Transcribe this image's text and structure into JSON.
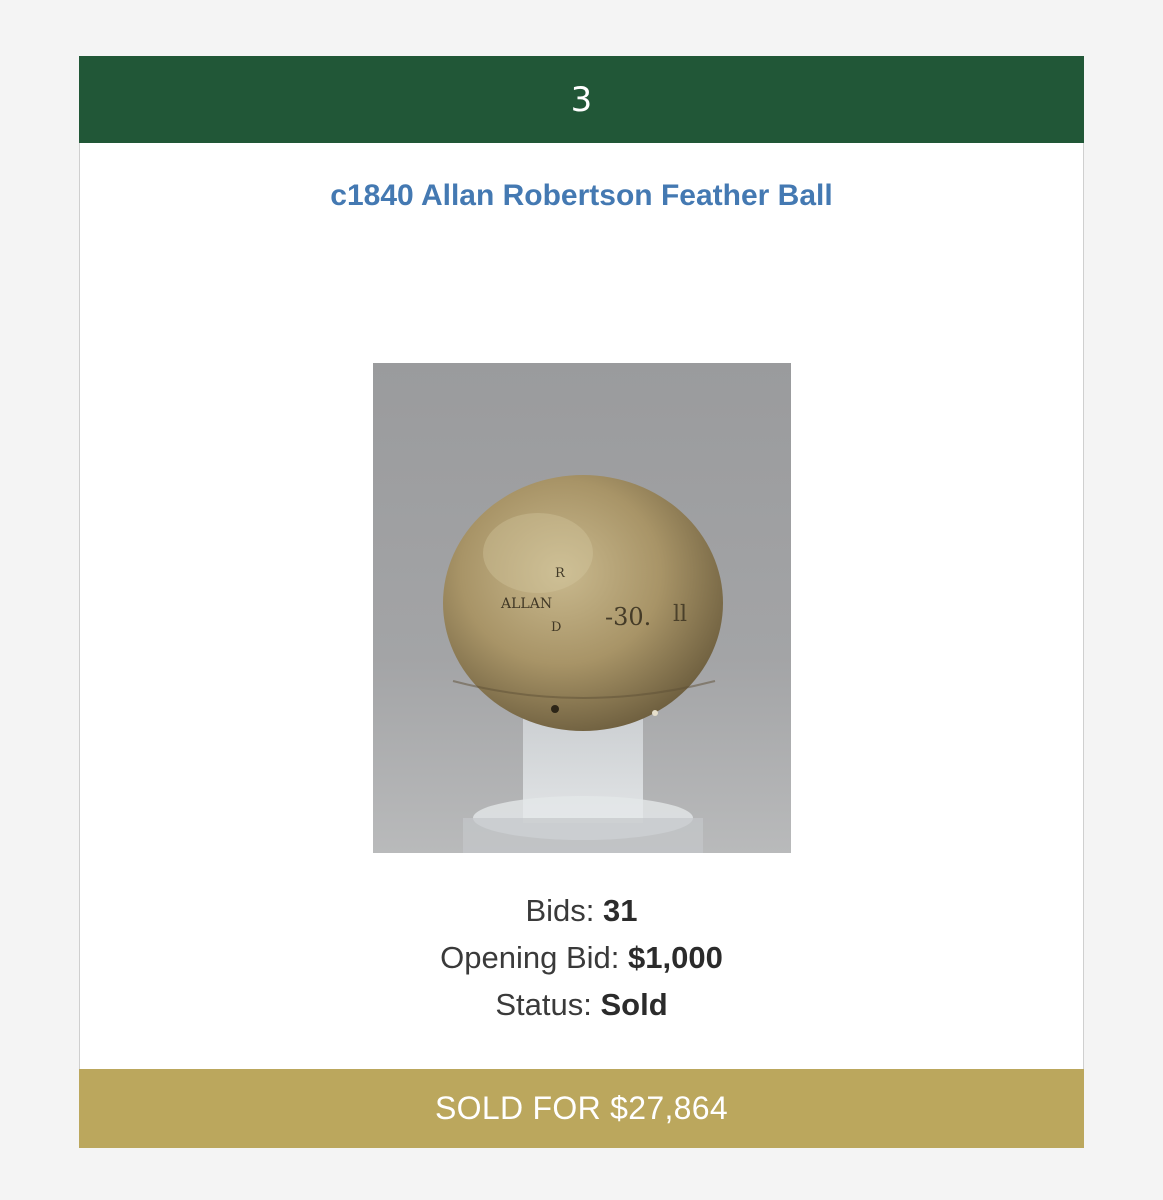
{
  "lot": {
    "number": "3",
    "title": "c1840 Allan Robertson Feather Ball",
    "image_alt": "feather-golf-ball-photo"
  },
  "details": {
    "bids_label": "Bids:",
    "bids_value": "31",
    "opening_label": "Opening Bid:",
    "opening_value": "$1,000",
    "status_label": "Status:",
    "status_value": "Sold"
  },
  "sold": {
    "text": "SOLD FOR $27,864"
  },
  "colors": {
    "header_green": "#215737",
    "title_blue": "#4479b2",
    "sold_gold": "#bba75d"
  }
}
